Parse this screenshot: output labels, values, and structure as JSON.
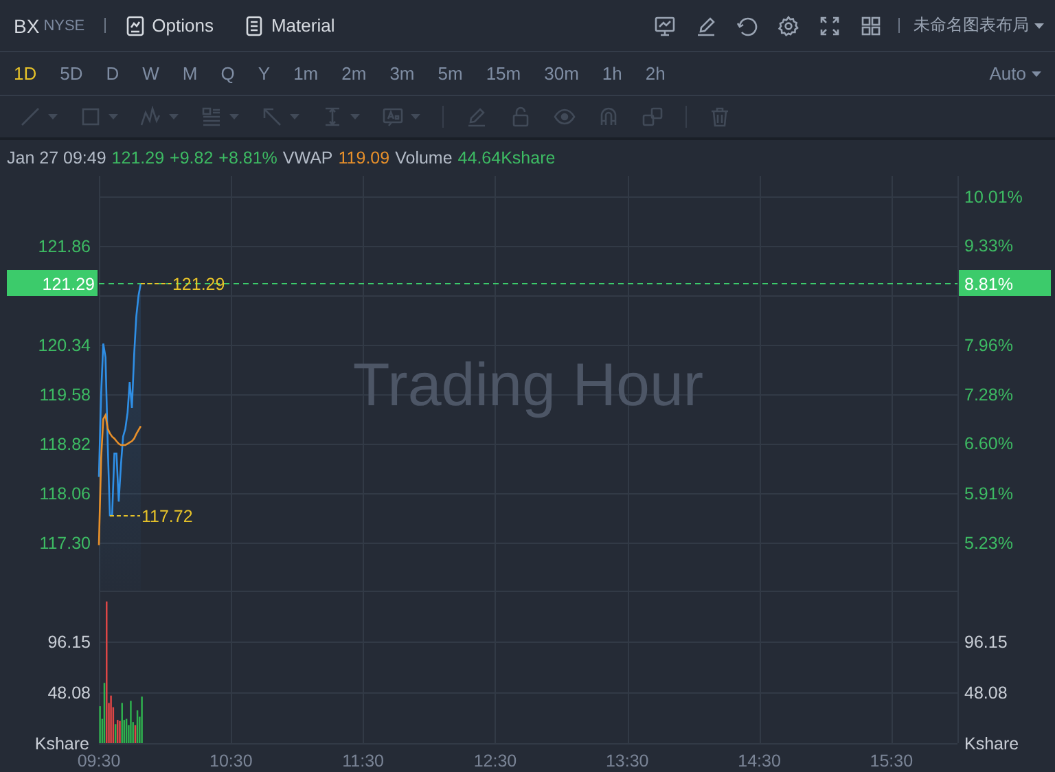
{
  "header": {
    "symbol": "BX",
    "exchange": "NYSE",
    "buttons": [
      {
        "label": "Options",
        "kind": "options"
      },
      {
        "label": "Material",
        "kind": "material"
      }
    ],
    "layout_menu": "未命名图表布局"
  },
  "intervals": [
    {
      "label": "1D",
      "selected": true
    },
    {
      "label": "5D",
      "selected": false
    },
    {
      "label": "D",
      "selected": false
    },
    {
      "label": "W",
      "selected": false
    },
    {
      "label": "M",
      "selected": false
    },
    {
      "label": "Q",
      "selected": false
    },
    {
      "label": "Y",
      "selected": false
    },
    {
      "label": "1m",
      "selected": false
    },
    {
      "label": "2m",
      "selected": false
    },
    {
      "label": "3m",
      "selected": false
    },
    {
      "label": "5m",
      "selected": false
    },
    {
      "label": "15m",
      "selected": false
    },
    {
      "label": "30m",
      "selected": false
    },
    {
      "label": "1h",
      "selected": false
    },
    {
      "label": "2h",
      "selected": false
    }
  ],
  "scale_menu": "Auto",
  "drawing_tools": {
    "disabled": true
  },
  "info": [
    {
      "text": "Jan 27 09:49",
      "color": "#b4bcc8"
    },
    {
      "text": "121.29",
      "color": "#3dbb63"
    },
    {
      "text": "+9.82",
      "color": "#3dbb63"
    },
    {
      "text": "+8.81%",
      "color": "#3dbb63"
    },
    {
      "text": "VWAP",
      "color": "#b4bcc8"
    },
    {
      "text": "119.09",
      "color": "#e8902a"
    },
    {
      "text": "Volume",
      "color": "#b4bcc8"
    },
    {
      "text": "44.64Kshare",
      "color": "#3dbb63"
    }
  ],
  "watermark": "Trading Hour",
  "price_chart": {
    "change_badge": "8.81%",
    "chart_data": {
      "type": "line",
      "grid": true,
      "xlim": [
        9.5,
        16
      ],
      "ylim": [
        116.56,
        122.94
      ],
      "y2lim": [
        4.566,
        10.29
      ],
      "x": [
        9.5,
        9.517,
        9.533,
        9.55,
        9.567,
        9.583,
        9.6,
        9.617,
        9.633,
        9.65,
        9.667,
        9.683,
        9.7,
        9.717,
        9.733,
        9.75,
        9.767,
        9.783,
        9.8,
        9.817
      ],
      "series": [
        {
          "color": "#2f8fe6",
          "values": [
            118.31,
            119.6,
            120.36,
            120.15,
            118.8,
            117.72,
            117.72,
            118.67,
            118.67,
            117.93,
            118.5,
            118.93,
            119.05,
            119.3,
            119.77,
            119.37,
            120.2,
            120.78,
            121.1,
            121.29
          ]
        },
        {
          "color": "#e8902a",
          "values": [
            117.26,
            118.6,
            119.2,
            119.26,
            119.05,
            118.98,
            118.93,
            118.9,
            118.86,
            118.82,
            118.8,
            118.8,
            118.8,
            118.82,
            118.84,
            118.86,
            118.9,
            118.97,
            119.03,
            119.09
          ]
        }
      ],
      "yticks": [
        {
          "value": 121.86,
          "label": "121.86"
        },
        {
          "value": 120.34,
          "label": "120.34"
        },
        {
          "value": 119.58,
          "label": "119.58"
        },
        {
          "value": 118.82,
          "label": "118.82"
        },
        {
          "value": 118.06,
          "label": "118.06"
        },
        {
          "value": 117.3,
          "label": "117.30"
        }
      ],
      "y2ticks": [
        {
          "value": 10.01,
          "label": "10.01%"
        },
        {
          "value": 9.33,
          "label": "9.33%"
        },
        {
          "value": 7.96,
          "label": "7.96%"
        },
        {
          "value": 7.28,
          "label": "7.28%"
        },
        {
          "value": 6.6,
          "label": "6.60%"
        },
        {
          "value": 5.91,
          "label": "5.91%"
        },
        {
          "value": 5.23,
          "label": "5.23%"
        }
      ],
      "ref_lines": [
        {
          "axis": "y",
          "value": 121.29,
          "label": "121.29"
        }
      ],
      "annotations": [
        {
          "x": 9.817,
          "y": 121.29,
          "text": "121.29"
        },
        {
          "x": 9.583,
          "y": 117.72,
          "text": "117.72"
        }
      ]
    }
  },
  "volume_chart": {
    "chart_data": {
      "type": "bar",
      "grid": true,
      "xlim": [
        9.5,
        16
      ],
      "ylim": [
        0,
        144.2
      ],
      "y2lim": [
        0,
        144.2
      ],
      "ylabel": "Kshare",
      "y2label": "Kshare",
      "x": [
        9.5,
        9.517,
        9.533,
        9.55,
        9.567,
        9.583,
        9.6,
        9.617,
        9.633,
        9.65,
        9.667,
        9.683,
        9.7,
        9.717,
        9.733,
        9.75,
        9.767,
        9.783,
        9.8,
        9.817
      ],
      "series": [
        {
          "color": "#2fb14e",
          "values": [
            35,
            23,
            57,
            null,
            null,
            null,
            null,
            18,
            null,
            null,
            38,
            22,
            23,
            17,
            40,
            20,
            null,
            31,
            25,
            44
          ]
        },
        {
          "color": "#e04646",
          "values": [
            null,
            null,
            null,
            134,
            38,
            45,
            34,
            null,
            22,
            21,
            null,
            null,
            null,
            null,
            null,
            null,
            17,
            null,
            null,
            null
          ]
        }
      ],
      "yticks": [
        {
          "value": 96.15,
          "label": "96.15"
        },
        {
          "value": 48.08,
          "label": "48.08"
        }
      ],
      "y2ticks": [
        {
          "value": 96.15,
          "label": "96.15"
        },
        {
          "value": 48.08,
          "label": "48.08"
        }
      ],
      "xticks": [
        {
          "value": 9.5,
          "label": "09:30"
        },
        {
          "value": 10.5,
          "label": "10:30"
        },
        {
          "value": 11.5,
          "label": "11:30"
        },
        {
          "value": 12.5,
          "label": "12:30"
        },
        {
          "value": 13.5,
          "label": "13:30"
        },
        {
          "value": 14.5,
          "label": "14:30"
        },
        {
          "value": 15.5,
          "label": "15:30"
        }
      ]
    }
  }
}
